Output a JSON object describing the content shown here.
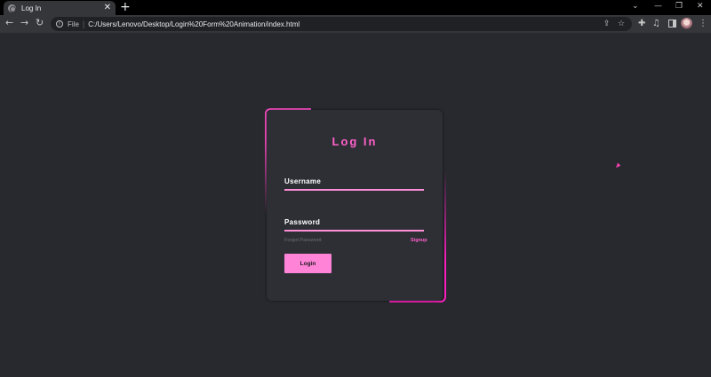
{
  "browser": {
    "tab": {
      "title": "Log In",
      "favicon": "globe-icon"
    },
    "address": {
      "scheme_label": "File",
      "url": "C:/Users/Lenovo/Desktop/Login%20Form%20Animation/index.html"
    },
    "icons": {
      "back": "arrow-left-icon",
      "forward": "arrow-right-icon",
      "reload": "reload-icon",
      "info": "info-icon",
      "share": "share-icon",
      "bookmark": "star-icon",
      "extensions": "puzzle-icon",
      "media": "media-icon",
      "sidepanel": "sidepanel-icon",
      "menu": "kebab-icon"
    }
  },
  "login": {
    "title": "Log In",
    "username_label": "Username",
    "username_value": "",
    "password_label": "Password",
    "password_value": "",
    "forgot_label": "Forgot Password",
    "signup_label": "Signup",
    "submit_label": "Login"
  },
  "colors": {
    "page_bg": "#28292f",
    "card_bg": "#2e2f35",
    "accent": "#ff5fc9",
    "button": "#ff83d7"
  }
}
